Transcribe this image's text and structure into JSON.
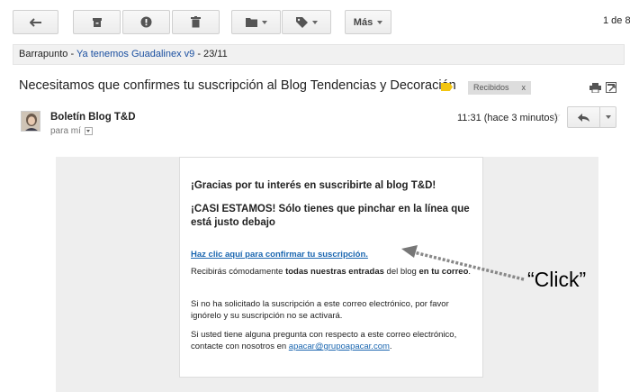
{
  "toolbar": {
    "back_icon": "arrow-back-icon",
    "archive_icon": "archive-icon",
    "spam_icon": "report-spam-icon",
    "delete_icon": "trash-icon",
    "folder_icon": "folder-icon",
    "label_icon": "label-tag-icon",
    "more_label": "Más",
    "pager": "1 de 8"
  },
  "promo": {
    "source": "Barrapunto",
    "separator": " - ",
    "link": "Ya tenemos Guadalinex v9",
    "suffix": " - 23/11"
  },
  "email": {
    "subject": "Necesitamos que confirmes tu suscripción al Blog Tendencias y Decoración",
    "label_color": "#f2c511",
    "chip_label": "Recibidos",
    "chip_close": "x",
    "sender": "Boletín Blog T&D",
    "to": "para mí",
    "time": "11:31 (hace 3 minutos)",
    "star": "☆"
  },
  "content": {
    "heading1": "¡Gracias por tu interés en suscribirte al blog T&D!",
    "heading2": "¡CASI ESTAMOS! Sólo tienes que pinchar en la línea que está justo debajo",
    "confirm_link": "Haz clic aquí para confirmar tu suscripción.",
    "p1_start": "Recibirás cómodamente ",
    "p1_bold": "todas nuestras entradas",
    "p1_mid": " del blog ",
    "p1_bold2": "en tu correo",
    "p1_end": ".",
    "p2": "Si no ha solicitado la suscripción a este correo electrónico, por favor ignórelo y su suscripción no se activará.",
    "p3_start": "Si usted tiene alguna pregunta con respecto a este correo electrónico, contacte con nosotros en ",
    "p3_email": "apacar@grupoapacar.com",
    "p3_end": "."
  },
  "annotation": {
    "label": "“Click”"
  }
}
